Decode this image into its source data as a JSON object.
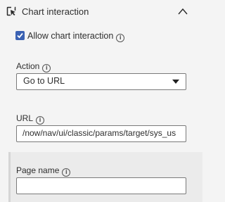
{
  "header": {
    "title": "Chart interaction",
    "icon": "cursor-select-icon",
    "collapse_icon": "chevron-up-icon"
  },
  "allow_interaction": {
    "label": "Allow chart interaction",
    "checked": true
  },
  "action": {
    "label": "Action",
    "value": "Go to URL"
  },
  "url": {
    "label": "URL",
    "value": "/now/nav/ui/classic/params/target/sys_us"
  },
  "page_name": {
    "label": "Page name",
    "value": ""
  },
  "info_glyph": "i"
}
